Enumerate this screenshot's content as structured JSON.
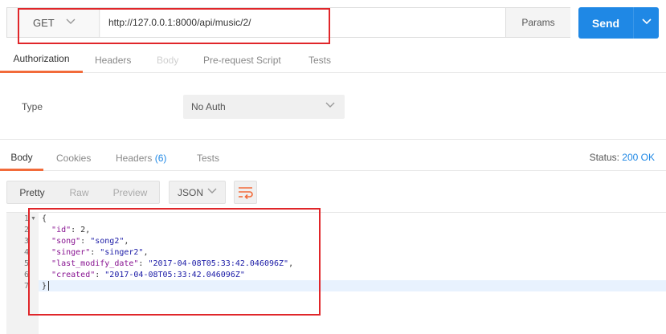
{
  "request": {
    "method": "GET",
    "url": "http://127.0.0.1:8000/api/music/2/",
    "params_label": "Params",
    "send_label": "Send"
  },
  "request_tabs": [
    {
      "label": "Authorization",
      "active": true
    },
    {
      "label": "Headers"
    },
    {
      "label": "Body",
      "disabled": true
    },
    {
      "label": "Pre-request Script"
    },
    {
      "label": "Tests"
    }
  ],
  "auth": {
    "type_label": "Type",
    "selected": "No Auth"
  },
  "response_tabs": [
    {
      "label": "Body",
      "active": true
    },
    {
      "label": "Cookies"
    },
    {
      "label": "Headers",
      "count": "(6)"
    },
    {
      "label": "Tests"
    }
  ],
  "status": {
    "label": "Status:",
    "code": "200 OK"
  },
  "format": {
    "modes": [
      "Pretty",
      "Raw",
      "Preview"
    ],
    "active_mode": "Pretty",
    "language": "JSON"
  },
  "response_body": {
    "line_numbers": [
      "1",
      "2",
      "3",
      "4",
      "5",
      "6",
      "7"
    ],
    "lines": [
      [
        {
          "t": "{",
          "c": "n"
        }
      ],
      [
        {
          "t": "  ",
          "c": "n"
        },
        {
          "t": "\"id\"",
          "c": "k"
        },
        {
          "t": ": 2,",
          "c": "n"
        }
      ],
      [
        {
          "t": "  ",
          "c": "n"
        },
        {
          "t": "\"song\"",
          "c": "k"
        },
        {
          "t": ": ",
          "c": "n"
        },
        {
          "t": "\"song2\"",
          "c": "s"
        },
        {
          "t": ",",
          "c": "n"
        }
      ],
      [
        {
          "t": "  ",
          "c": "n"
        },
        {
          "t": "\"singer\"",
          "c": "k"
        },
        {
          "t": ": ",
          "c": "n"
        },
        {
          "t": "\"singer2\"",
          "c": "s"
        },
        {
          "t": ",",
          "c": "n"
        }
      ],
      [
        {
          "t": "  ",
          "c": "n"
        },
        {
          "t": "\"last_modify_date\"",
          "c": "k"
        },
        {
          "t": ": ",
          "c": "n"
        },
        {
          "t": "\"2017-04-08T05:33:42.046096Z\"",
          "c": "s"
        },
        {
          "t": ",",
          "c": "n"
        }
      ],
      [
        {
          "t": "  ",
          "c": "n"
        },
        {
          "t": "\"created\"",
          "c": "k"
        },
        {
          "t": ": ",
          "c": "n"
        },
        {
          "t": "\"2017-04-08T05:33:42.046096Z\"",
          "c": "s"
        }
      ],
      [
        {
          "t": "}",
          "c": "n"
        }
      ]
    ]
  },
  "colors": {
    "accent": "#1f88e5",
    "active_tab": "#f26b3a",
    "annotation": "#e0262a"
  },
  "icons": {
    "method_dropdown": "chevron-down-icon",
    "send_dropdown": "chevron-down-icon",
    "wrap": "wrap-lines-icon",
    "fold": "fold-triangle-icon"
  }
}
